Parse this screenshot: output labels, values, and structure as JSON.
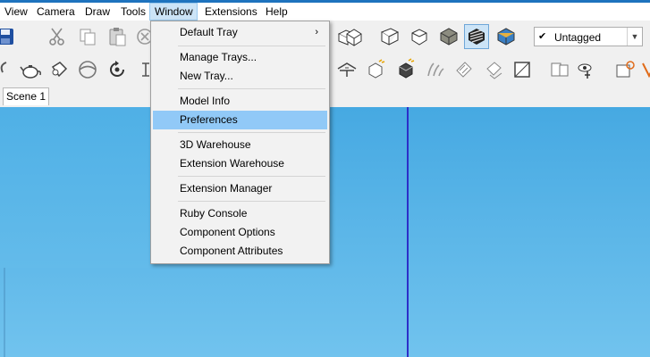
{
  "menubar": {
    "items": [
      "View",
      "Camera",
      "Draw",
      "Tools",
      "Window",
      "Extensions",
      "Help"
    ]
  },
  "window_menu": {
    "groups": [
      [
        "Default Tray"
      ],
      [
        "Manage Trays...",
        "New Tray..."
      ],
      [
        "Model Info",
        "Preferences"
      ],
      [
        "3D Warehouse",
        "Extension Warehouse"
      ],
      [
        "Extension Manager"
      ],
      [
        "Ruby Console",
        "Component Options",
        "Component Attributes"
      ]
    ],
    "highlighted": "Preferences",
    "submenu_item": "Default Tray"
  },
  "tag_selector": {
    "value": "Untagged"
  },
  "scenes": {
    "tab": "Scene 1"
  },
  "colors": {
    "menu_highlight": "#91c9f7",
    "active_menu": "#cce4f7",
    "viewport_top": "#46a9e2",
    "viewport_bottom": "#71c3ee",
    "axis_blue": "#2c2fc9"
  },
  "toolbar1": {
    "icons": [
      "save-icon",
      "cut-icon",
      "copy-icon",
      "paste-icon",
      "erase-icon",
      "standard-view-icon",
      "iso-view-icon",
      "top-view-icon",
      "front-view-icon",
      "xray-style-icon",
      "wireframe-style-icon",
      "hidden-line-style-icon",
      "shaded-style-icon",
      "shaded-textures-style-icon",
      "monochrome-style-icon"
    ]
  },
  "toolbar2": {
    "icons": [
      "teapot-icon",
      "paint-bucket-icon",
      "orbit-icon",
      "rotate-icon",
      "measure-icon",
      "section-plane-icon",
      "solid-tools-icon",
      "outer-shell-icon",
      "sandbox-icon",
      "warehouse-icon",
      "shadow-icon",
      "box-icon",
      "position-camera-icon",
      "look-around-icon",
      "lighting-icon"
    ]
  }
}
